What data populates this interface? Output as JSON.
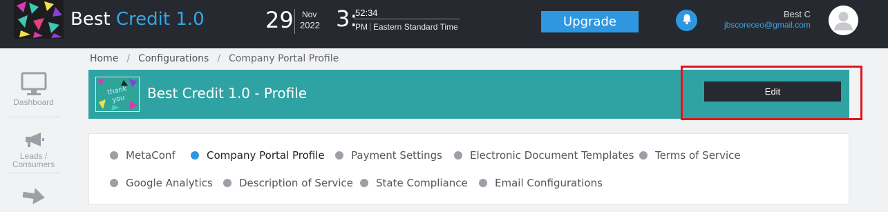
{
  "header": {
    "app_title_main": "Best",
    "app_title_accent": "Credit 1.0",
    "date": {
      "day": "29",
      "month": "Nov",
      "year": "2022"
    },
    "time": {
      "hour": "3:",
      "minsec": "52:34",
      "ampm": "PM",
      "timezone": "Eastern Standard Time"
    },
    "upgrade_label": "Upgrade",
    "user_name": "Best C",
    "user_email": "jbscoreceo@gmail.com"
  },
  "sidebar": {
    "items": [
      {
        "label": "Dashboard",
        "icon": "monitor-icon"
      },
      {
        "label_line1": "Leads /",
        "label_line2": "Consumers",
        "icon": "megaphone-icon"
      },
      {
        "icon": "arrow-right-icon"
      }
    ]
  },
  "breadcrumb": {
    "items": [
      "Home",
      "Configurations",
      "Company Portal Profile"
    ],
    "separator": "/"
  },
  "banner": {
    "title": "Best Credit 1.0 - Profile",
    "thumb_text_1": "thank",
    "thumb_text_2": "you",
    "edit_label": "Edit",
    "color": "#2fa3a3"
  },
  "tabs": [
    {
      "label": "MetaConf",
      "active": false
    },
    {
      "label": "Company Portal Profile",
      "active": true
    },
    {
      "label": "Payment Settings",
      "active": false
    },
    {
      "label": "Electronic Document Templates",
      "active": false
    },
    {
      "label": "Terms of Service",
      "active": false
    },
    {
      "label": "Google Analytics",
      "active": false
    },
    {
      "label": "Description of Service",
      "active": false
    },
    {
      "label": "State Compliance",
      "active": false
    },
    {
      "label": "Email Configurations",
      "active": false
    }
  ],
  "colors": {
    "topbar": "#262a30",
    "accent_blue": "#2e97e0",
    "highlight_red": "#e1141b"
  }
}
